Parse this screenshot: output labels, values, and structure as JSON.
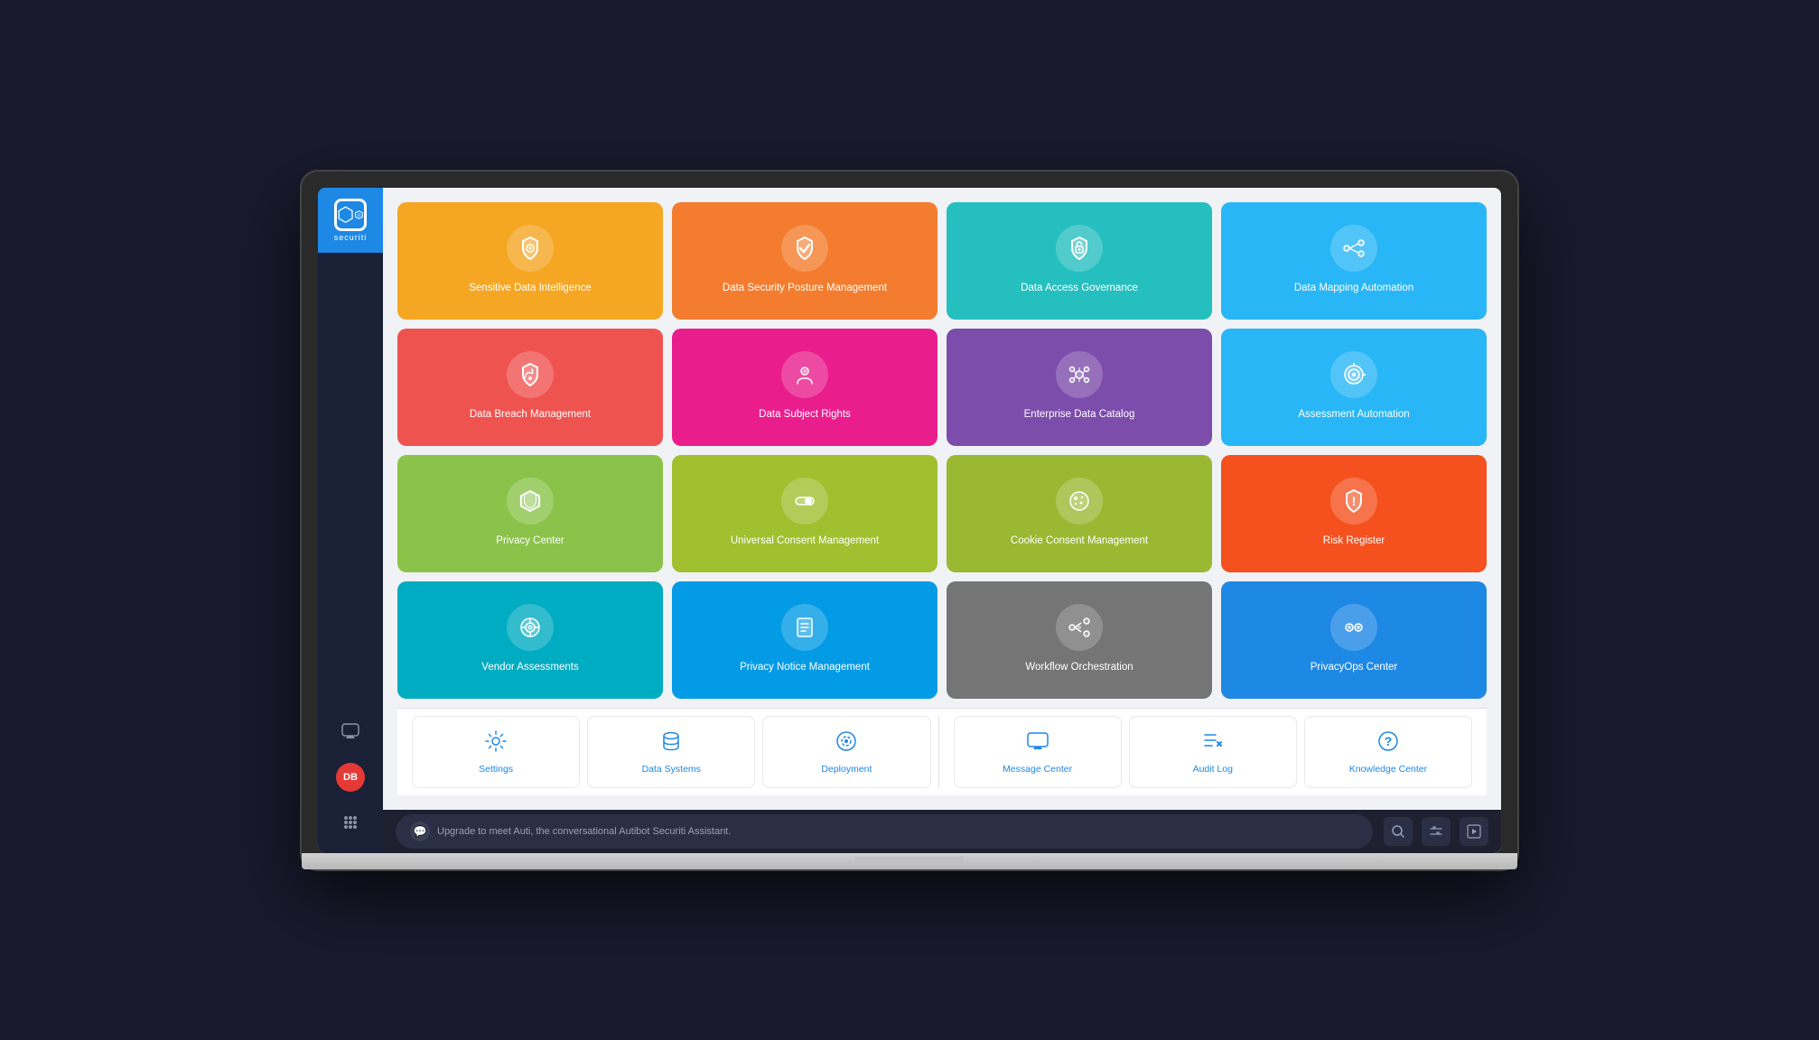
{
  "app": {
    "name": "securiti",
    "logo_text": "securiti"
  },
  "sidebar": {
    "bottom_icons": [
      "💬",
      "DB",
      "⠿"
    ]
  },
  "cards": {
    "row1": [
      {
        "id": "sensitive-data-intelligence",
        "label": "Sensitive Data Intelligence",
        "color": "card-orange",
        "icon": "shield"
      },
      {
        "id": "data-security-posture-management",
        "label": "Data Security Posture Management",
        "color": "card-orange2",
        "icon": "shield-check"
      },
      {
        "id": "data-access-governance",
        "label": "Data Access Governance",
        "color": "card-teal",
        "icon": "lock-shield"
      },
      {
        "id": "data-mapping-automation",
        "label": "Data Mapping Automation",
        "color": "card-lightblue",
        "icon": "share"
      }
    ],
    "row2": [
      {
        "id": "data-breach-management",
        "label": "Data Breach Management",
        "color": "card-red",
        "icon": "wifi-shield"
      },
      {
        "id": "data-subject-rights",
        "label": "Data Subject Rights",
        "color": "card-pink",
        "icon": "gear-shield"
      },
      {
        "id": "enterprise-data-catalog",
        "label": "Enterprise Data Catalog",
        "color": "card-purple",
        "icon": "nodes"
      },
      {
        "id": "assessment-automation",
        "label": "Assessment Automation",
        "color": "card-blue",
        "icon": "target"
      }
    ],
    "row3": [
      {
        "id": "privacy-center",
        "label": "Privacy Center",
        "color": "card-green",
        "icon": "hexagon-shield"
      },
      {
        "id": "universal-consent-management",
        "label": "Universal Consent Management",
        "color": "card-limegreen",
        "icon": "toggle"
      },
      {
        "id": "cookie-consent-management",
        "label": "Cookie Consent Management",
        "color": "card-limegreen2",
        "icon": "cookie"
      },
      {
        "id": "risk-register",
        "label": "Risk Register",
        "color": "card-orange-red",
        "icon": "exclaim-shield"
      }
    ],
    "row4": [
      {
        "id": "vendor-assessments",
        "label": "Vendor Assessments",
        "color": "card-cyan",
        "icon": "gear-ring"
      },
      {
        "id": "privacy-notice-management",
        "label": "Privacy Notice Management",
        "color": "card-skyblue",
        "icon": "document"
      },
      {
        "id": "workflow-orchestration",
        "label": "Workflow Orchestration",
        "color": "card-gray",
        "icon": "network"
      },
      {
        "id": "privacyops-center",
        "label": "PrivacyOps Center",
        "color": "card-blue2",
        "icon": "eyes"
      }
    ]
  },
  "utility": {
    "left": [
      {
        "id": "settings",
        "label": "Settings",
        "icon": "⚙"
      },
      {
        "id": "data-systems",
        "label": "Data Systems",
        "icon": "🗄"
      },
      {
        "id": "deployment",
        "label": "Deployment",
        "icon": "⚙"
      }
    ],
    "right": [
      {
        "id": "message-center",
        "label": "Message Center",
        "icon": "💬"
      },
      {
        "id": "audit-log",
        "label": "Audit Log",
        "icon": "≡×"
      },
      {
        "id": "knowledge-center",
        "label": "Knowledge Center",
        "icon": "?"
      }
    ]
  },
  "status_bar": {
    "chat_placeholder": "Upgrade to meet Auti, the conversational Autibot Securiti Assistant.",
    "actions": [
      "🔍",
      "⚙",
      "▶"
    ]
  }
}
